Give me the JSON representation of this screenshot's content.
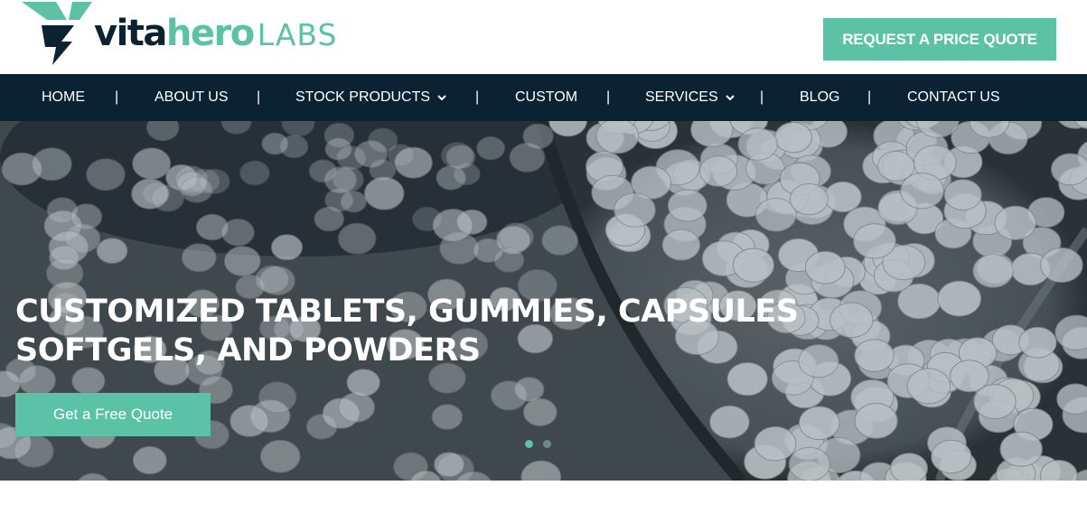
{
  "brand": {
    "name_part1": "vita",
    "name_part2": "hero",
    "name_part3": "LABS",
    "primary_color": "#0b2233",
    "accent_color": "#5cc2a6",
    "logo_icon": "v-lightning-logo-icon"
  },
  "header": {
    "quote_button_label": "REQUEST A PRICE QUOTE"
  },
  "nav": {
    "items": [
      {
        "label": "HOME"
      },
      {
        "label": "ABOUT US"
      },
      {
        "label": "STOCK PRODUCTS",
        "has_dropdown": true
      },
      {
        "label": "CUSTOM"
      },
      {
        "label": "SERVICES",
        "has_dropdown": true
      },
      {
        "label": "BLOG"
      },
      {
        "label": "CONTACT US"
      }
    ],
    "separator": "|",
    "dropdown_icon": "chevron-down-icon"
  },
  "hero": {
    "title_line1": "CUSTOMIZED TABLETS, GUMMIES, CAPSULES",
    "title_line2": "SOFTGELS, AND POWDERS",
    "cta_label": "Get a Free Quote",
    "slides_total": 2,
    "active_slide": 1,
    "background_description_icon": "tablets-background-image"
  }
}
